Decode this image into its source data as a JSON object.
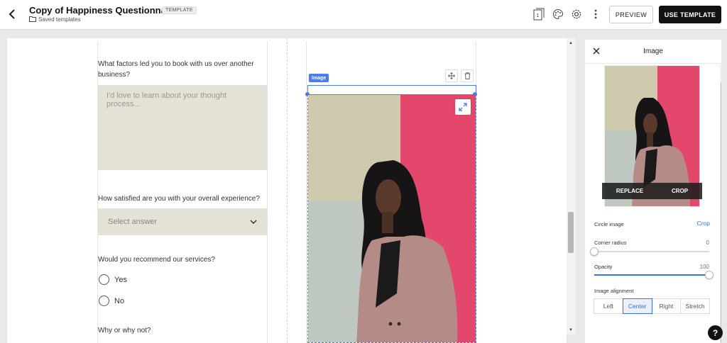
{
  "header": {
    "title": "Copy of Happiness Questionnaire",
    "badge": "TEMPLATE",
    "breadcrumb": "Saved templates",
    "preview_label": "PREVIEW",
    "use_template_label": "USE TEMPLATE",
    "page_count_icon": "1"
  },
  "form": {
    "q1": "What factors led you to book with us over another business?",
    "q1_placeholder": "I'd love to learn about your thought process...",
    "q2": "How satisfied are you with your overall experience?",
    "q2_select": "Select answer",
    "q3": "Would you recommend our services?",
    "q3_options": [
      "Yes",
      "No"
    ],
    "q4": "Why or why not?"
  },
  "image_block": {
    "tag": "Image"
  },
  "panel": {
    "title": "Image",
    "replace_label": "REPLACE",
    "crop_label": "CROP",
    "circle_image_label": "Circle image",
    "circle_image_link": "Crop",
    "corner_radius_label": "Corner radius",
    "corner_radius_value": "0",
    "corner_radius_fraction": 0,
    "opacity_label": "Opacity",
    "opacity_value": "100",
    "opacity_fraction": 1,
    "alignment_label": "Image alignment",
    "alignment_options": [
      "Left",
      "Center",
      "Right",
      "Stretch"
    ],
    "alignment_selected": "Center"
  },
  "help_label": "?",
  "colors": {
    "accent": "#3b6ff0",
    "selection": "#4a7cf2",
    "field_bg": "#e4e1d6",
    "photo_pink": "#e3476b",
    "photo_beige": "#cfc9ad"
  }
}
